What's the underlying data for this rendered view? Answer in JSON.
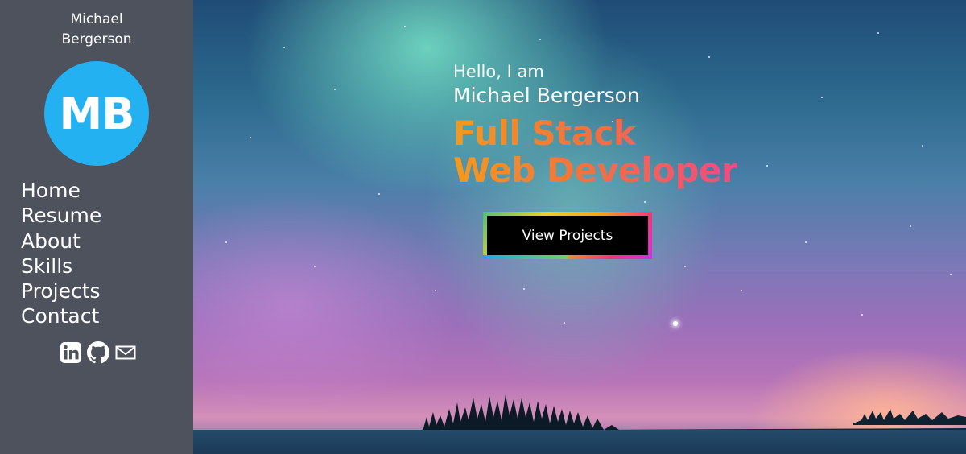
{
  "sidebar": {
    "owner_name": "Michael Bergerson",
    "avatar_initials": "MB",
    "avatar_color": "#23b1f2",
    "nav": [
      {
        "label": "Home"
      },
      {
        "label": "Resume"
      },
      {
        "label": "About"
      },
      {
        "label": "Skills"
      },
      {
        "label": "Projects"
      },
      {
        "label": "Contact"
      }
    ],
    "social_icons": [
      "linkedin-icon",
      "github-icon",
      "mail-icon"
    ]
  },
  "hero": {
    "greeting": "Hello, I am",
    "name": "Michael Bergerson",
    "role_line1": "Full Stack",
    "role_line2": "Web Developer",
    "cta_label": "View Projects"
  },
  "colors": {
    "sidebar_bg": "#4d525d",
    "role_gradient": [
      "#f49a1c",
      "#ef4b84"
    ]
  }
}
